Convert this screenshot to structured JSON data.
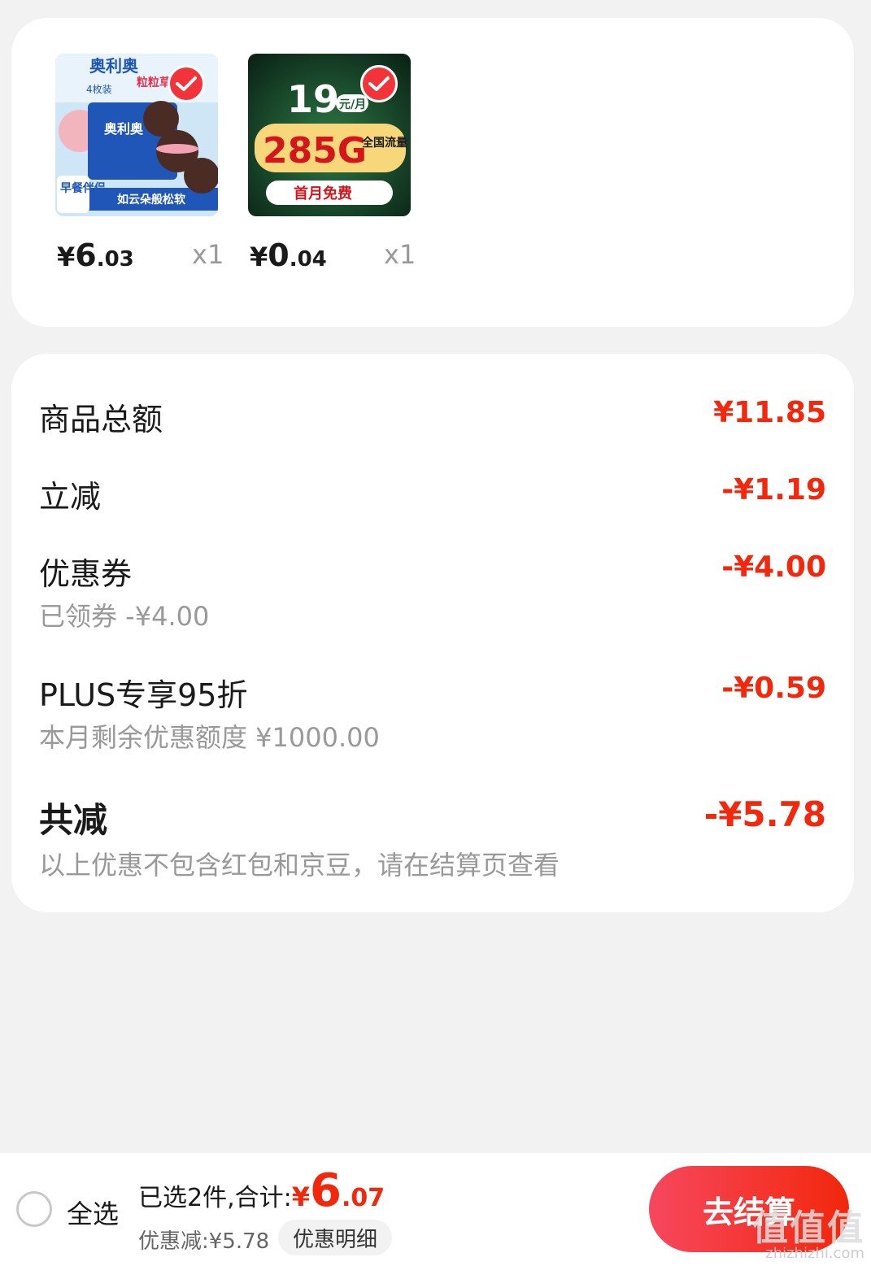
{
  "products": [
    {
      "name": "oreo-strawberry-cake",
      "image_texts": {
        "brand": "奥利奥",
        "pack": "4枚装",
        "flavor_tag": "粒粒草",
        "badge": "早餐伴侣",
        "slogan": "如云朵般松软"
      },
      "price_yen": "¥",
      "price_int": "6",
      "price_dec": ".03",
      "qty": "x1"
    },
    {
      "name": "china-telecom-data-plan",
      "image_texts": {
        "price_big": "19",
        "unit": "元/月",
        "data": "285G",
        "scope": "全国流量",
        "promo": "首月免费"
      },
      "price_yen": "¥",
      "price_int": "0",
      "price_dec": ".04",
      "qty": "x1"
    }
  ],
  "summary": {
    "goods_total": {
      "label": "商品总额",
      "amount": "¥11.85"
    },
    "instant_discount": {
      "label": "立减",
      "amount": "-¥1.19"
    },
    "coupon": {
      "label": "优惠券",
      "amount": "-¥4.00",
      "sub": "已领券 -¥4.00"
    },
    "plus": {
      "label": "PLUS专享95折",
      "amount": "-¥0.59",
      "sub": "本月剩余优惠额度 ¥1000.00"
    },
    "total_discount": {
      "label": "共减",
      "amount": "-¥5.78",
      "sub": "以上优惠不包含红包和京豆，请在结算页查看"
    }
  },
  "bottom_bar": {
    "select_all": "全选",
    "selected_text": "已选2件,合计:",
    "total_yen": "¥",
    "total_int": "6",
    "total_dec": ".07",
    "discount_text": "优惠减:¥5.78",
    "detail_button": "优惠明细",
    "checkout_button": "去结算"
  },
  "watermark": {
    "big": "值值值",
    "small": "zhizhizhi.com"
  },
  "colors": {
    "accent": "#f2270c",
    "check": "#f2333a",
    "background": "#f2f2f2"
  }
}
